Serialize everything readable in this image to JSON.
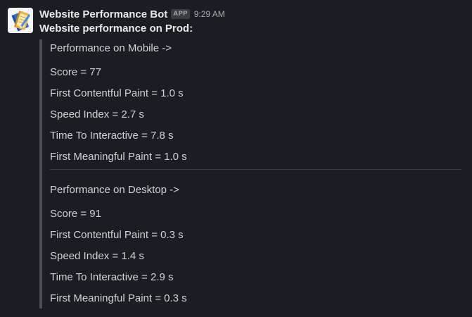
{
  "bot": {
    "name": "Website Performance Bot",
    "badge": "APP",
    "time": "9:29 AM",
    "avatar_icon": "notebook-icon"
  },
  "message": {
    "title": "Website performance on Prod:"
  },
  "mobile": {
    "heading": "Performance on Mobile ->",
    "score": "Score = 77",
    "fcp": "First Contentful Paint = 1.0 s",
    "speed_index": "Speed Index = 2.7 s",
    "tti": "Time To Interactive = 7.8 s",
    "fmp": "First Meaningful Paint = 1.0 s"
  },
  "desktop": {
    "heading": "Performance on Desktop ->",
    "score": "Score = 91",
    "fcp": "First Contentful Paint = 0.3 s",
    "speed_index": "Speed Index = 1.4 s",
    "tti": "Time To Interactive = 2.9 s",
    "fmp": "First Meaningful Paint = 0.3 s"
  },
  "colors": {
    "background": "#1a1d21",
    "text": "#d1d2d3",
    "attachment_bar": "#4a4d52"
  }
}
